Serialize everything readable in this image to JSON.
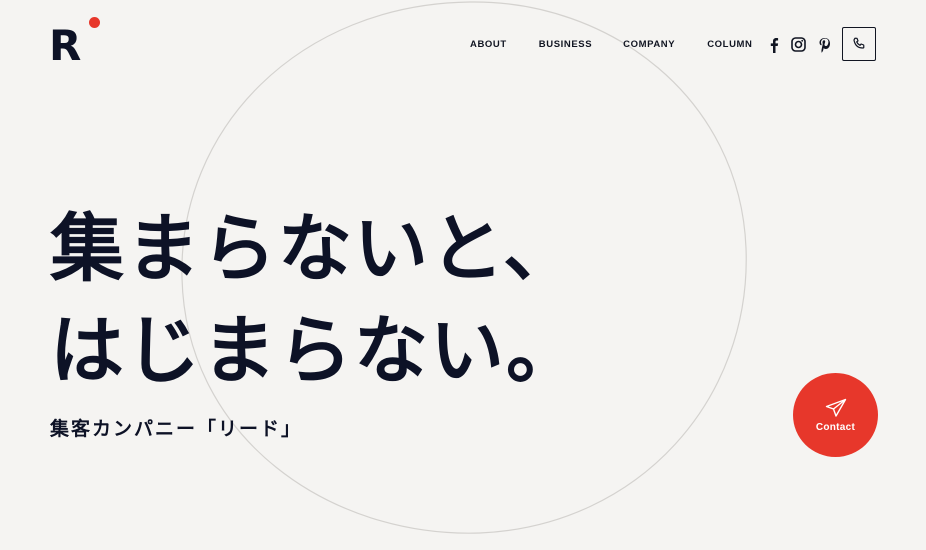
{
  "brand": {
    "logo_letter": "R",
    "dot_color": "#e7372b"
  },
  "nav": {
    "items": [
      {
        "label": "ABOUT"
      },
      {
        "label": "BUSINESS"
      },
      {
        "label": "COMPANY"
      },
      {
        "label": "COLUMN"
      }
    ]
  },
  "social": {
    "icons": [
      "facebook-icon",
      "instagram-icon",
      "pinterest-icon"
    ]
  },
  "header": {
    "phone_icon": "phone-icon"
  },
  "hero": {
    "line1": "集まらないと、",
    "line2": "はじまらない。",
    "subtitle": "集客カンパニー「リード」"
  },
  "contact": {
    "label": "Contact",
    "icon": "paper-plane-icon",
    "color": "#e7372b"
  }
}
